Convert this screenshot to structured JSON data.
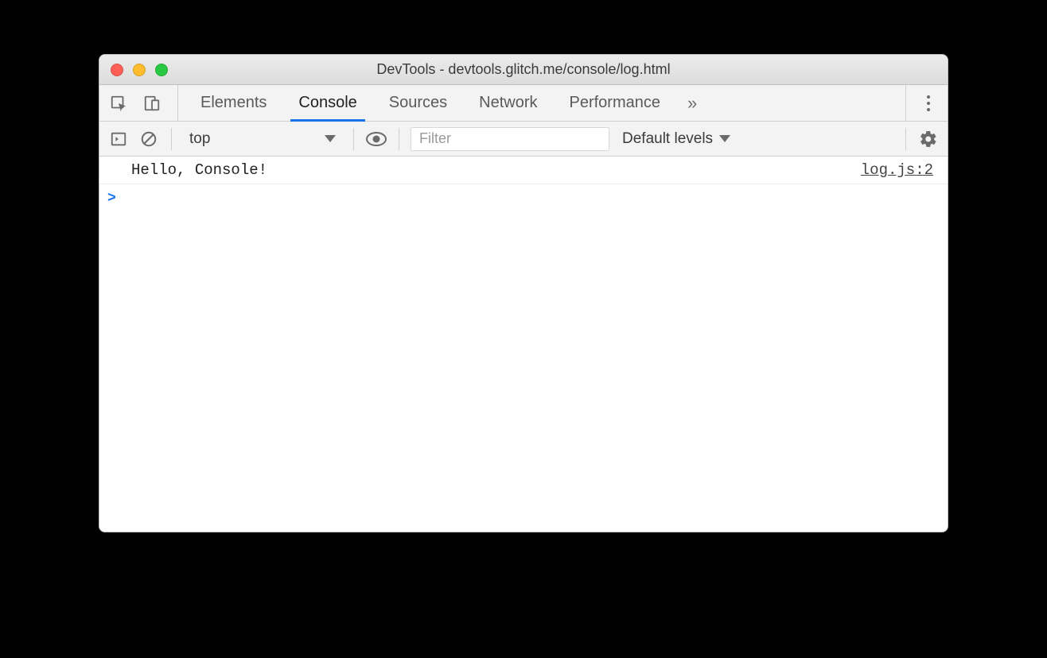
{
  "window": {
    "title": "DevTools - devtools.glitch.me/console/log.html"
  },
  "tabs": {
    "items": [
      "Elements",
      "Console",
      "Sources",
      "Network",
      "Performance"
    ],
    "active": "Console",
    "more_glyph": "»"
  },
  "toolbar": {
    "context": "top",
    "filter_placeholder": "Filter",
    "levels_label": "Default levels"
  },
  "console": {
    "logs": [
      {
        "message": "Hello, Console!",
        "source": "log.js:2"
      }
    ],
    "prompt": ">"
  }
}
